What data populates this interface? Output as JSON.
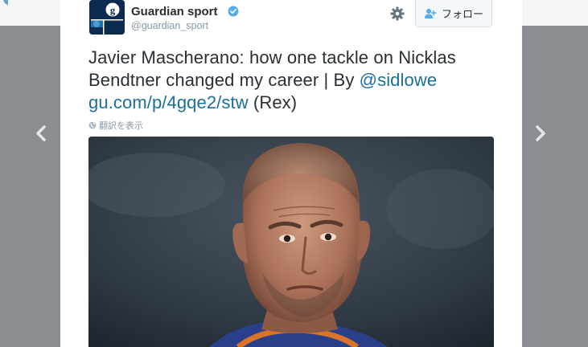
{
  "tweet": {
    "user_name": "Guardian sport",
    "user_handle": "@guardian_sport",
    "follow_label": "フォロー",
    "text_main": "Javier Mascherano: how one tackle on Nicklas Bendtner changed my career | By ",
    "mention": "@sidlowe",
    "link": "gu.com/p/4gqe2/stw",
    "text_tail": " (Rex)",
    "translate_label": "翻訳を表示",
    "verified": true
  },
  "icons": {
    "avatar": "guardian-logo",
    "verified": "verified-badge-icon",
    "settings": "gear-icon",
    "follow": "add-user-icon",
    "translate": "globe-icon",
    "prev": "chevron-left-icon",
    "next": "chevron-right-icon"
  },
  "colors": {
    "link": "#1b6e9c",
    "verified": "#55acee",
    "avatar_bg": "#0c2b4e"
  }
}
